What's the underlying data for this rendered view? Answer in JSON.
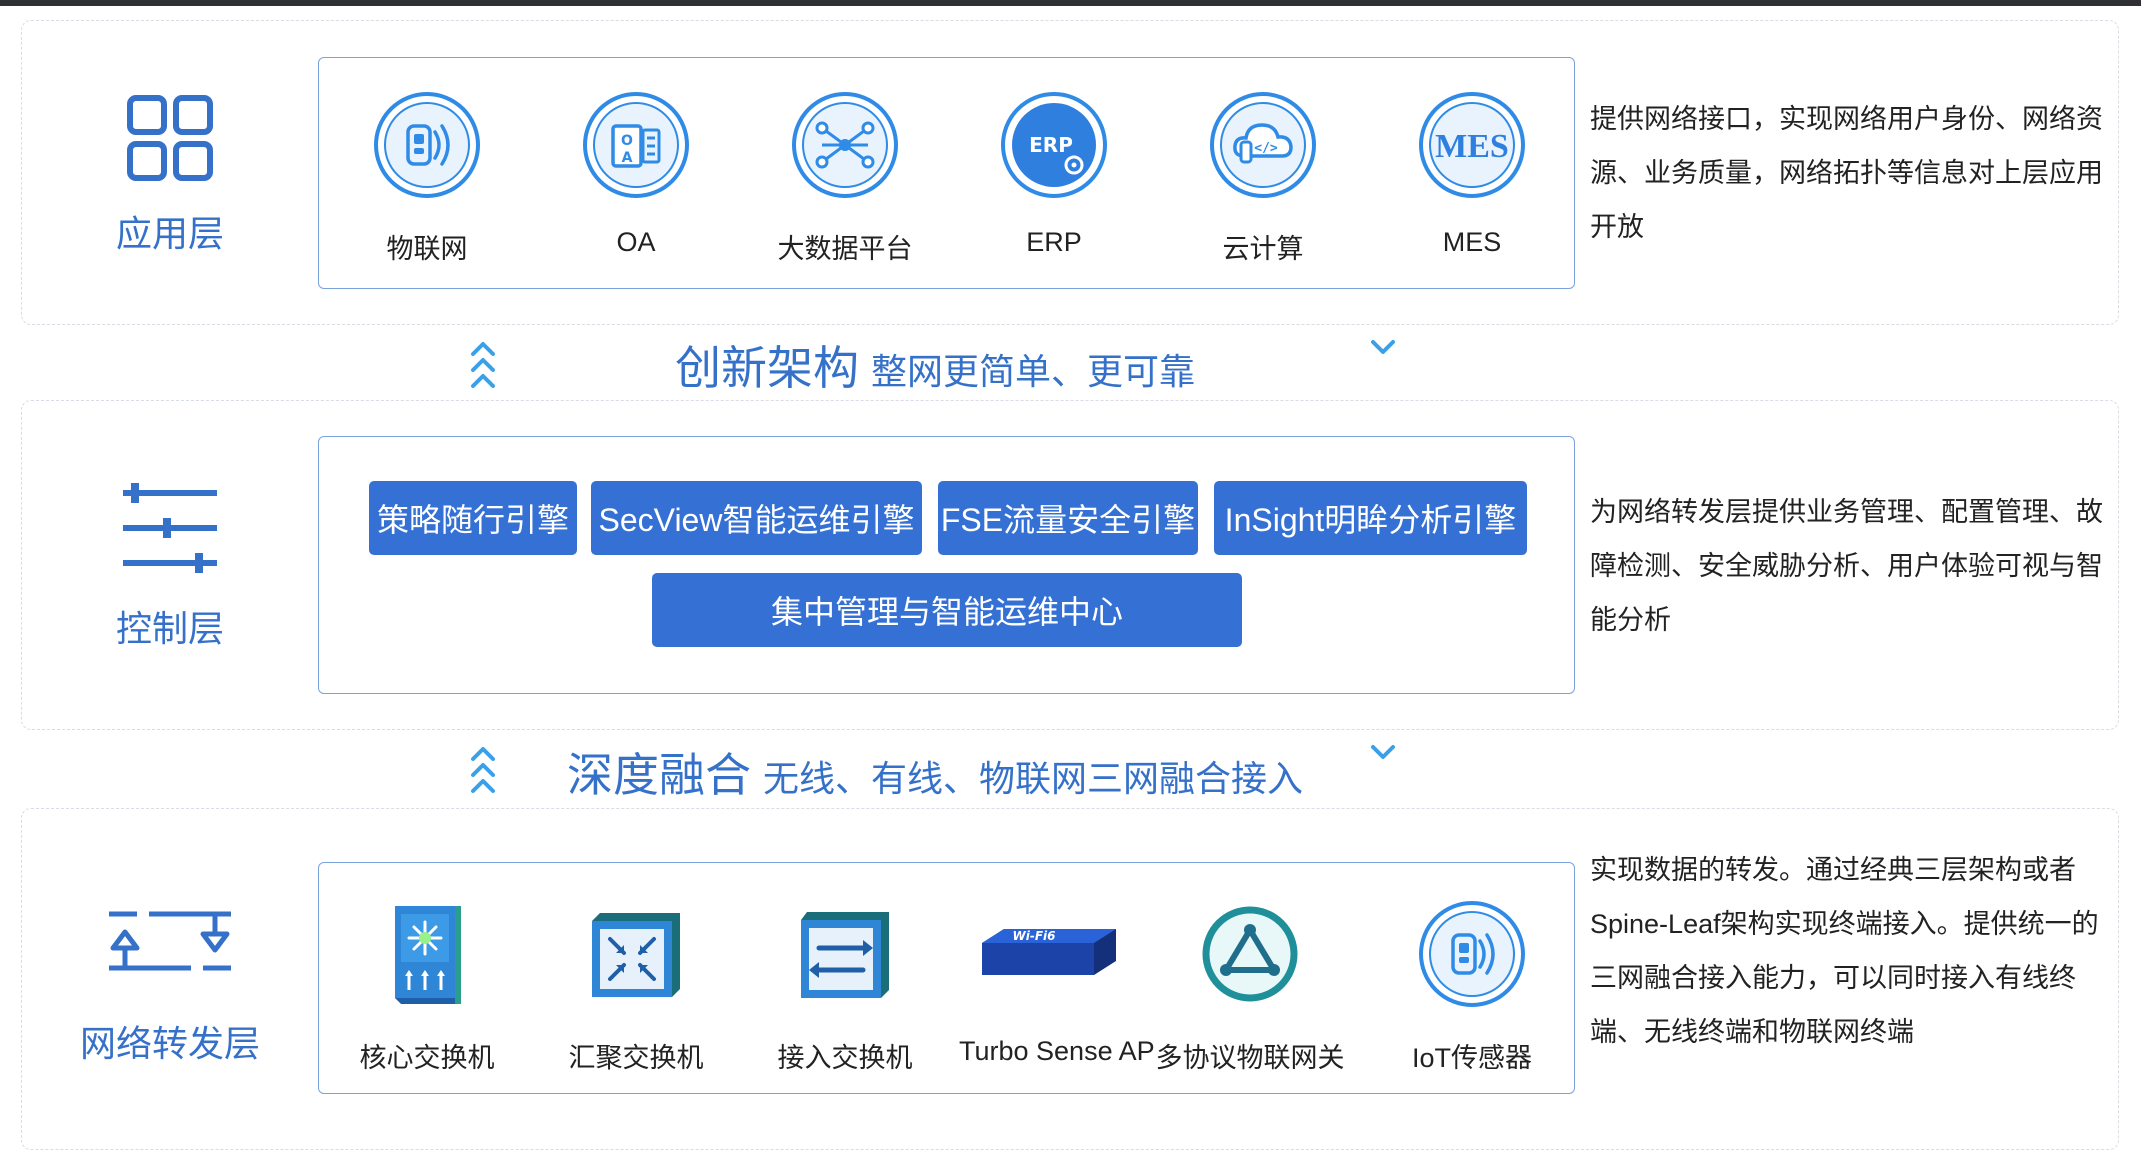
{
  "application_layer": {
    "title": "应用层",
    "icon": "grid-apps-icon",
    "description": "提供网络接口，实现网络用户身份、网络资源、业务质量，网络拓扑等信息对上层应用开放",
    "items": [
      {
        "label": "物联网",
        "icon": "iot-device-icon"
      },
      {
        "label": "OA",
        "icon": "oa-icon"
      },
      {
        "label": "大数据平台",
        "icon": "big-data-icon"
      },
      {
        "label": "ERP",
        "icon": "erp-icon"
      },
      {
        "label": "云计算",
        "icon": "cloud-computing-icon"
      },
      {
        "label": "MES",
        "icon": "mes-icon"
      }
    ]
  },
  "banner_1": {
    "title": "创新架构",
    "subtitle": "整网更简单、更可靠"
  },
  "control_layer": {
    "title": "控制层",
    "icon": "sliders-icon",
    "description": "为网络转发层提供业务管理、配置管理、故障检测、安全威胁分析、用户体验可视与智能分析",
    "engines": [
      "策略随行引擎",
      "SecView智能运维引擎",
      "FSE流量安全引擎",
      "InSight明眸分析引擎"
    ],
    "center": "集中管理与智能运维中心"
  },
  "banner_2": {
    "title": "深度融合",
    "subtitle": "无线、有线、物联网三网融合接入"
  },
  "forwarding_layer": {
    "title": "网络转发层",
    "icon": "forwarding-arrows-icon",
    "description": "实现数据的转发。通过经典三层架构或者Spine-Leaf架构实现终端接入。提供统一的三网融合接入能力，可以同时接入有线终端、无线终端和物联网终端",
    "items": [
      {
        "label": "核心交换机",
        "icon": "core-switch-icon"
      },
      {
        "label": "汇聚交换机",
        "icon": "aggregation-switch-icon"
      },
      {
        "label": "接入交换机",
        "icon": "access-switch-icon"
      },
      {
        "label": "Turbo Sense AP",
        "icon": "wifi-ap-icon",
        "badge": "Wi-Fi6"
      },
      {
        "label": "多协议物联网关",
        "icon": "iot-gateway-icon"
      },
      {
        "label": "IoT传感器",
        "icon": "iot-sensor-icon"
      }
    ]
  },
  "colors": {
    "accent": "#3571c9",
    "chip": "#3571d4",
    "icon_ring": "#2f8be6",
    "arrow": "#3aa0ea",
    "border": "#7aa3de"
  }
}
